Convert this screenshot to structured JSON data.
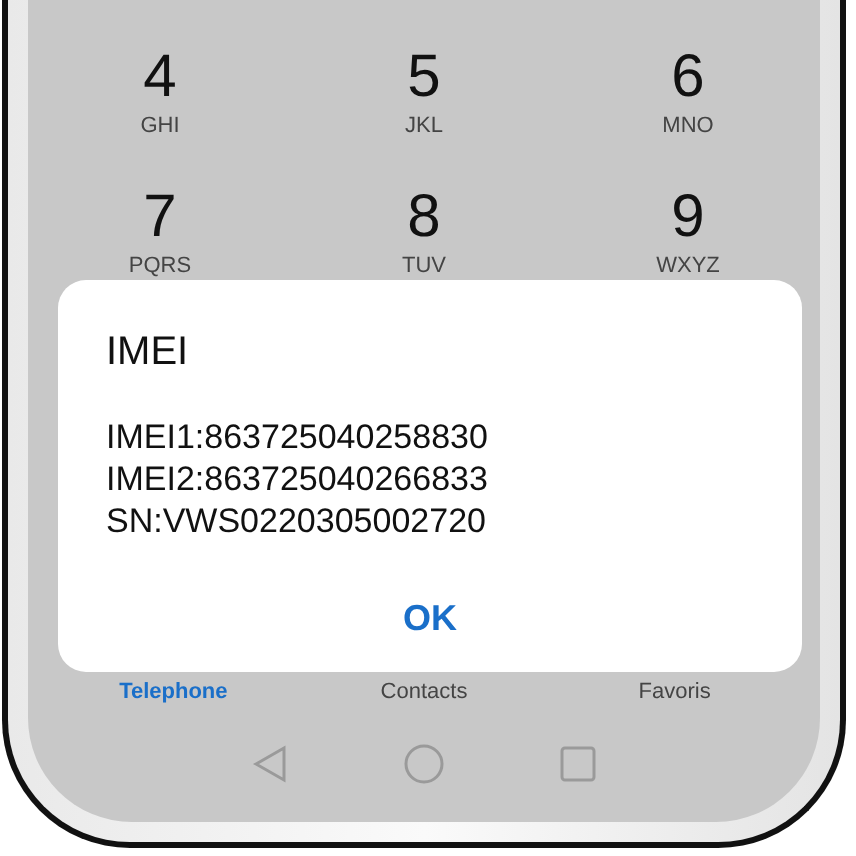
{
  "keypad": [
    {
      "digit": "4",
      "letters": "GHI"
    },
    {
      "digit": "5",
      "letters": "JKL"
    },
    {
      "digit": "6",
      "letters": "MNO"
    },
    {
      "digit": "7",
      "letters": "PQRS"
    },
    {
      "digit": "8",
      "letters": "TUV"
    },
    {
      "digit": "9",
      "letters": "WXYZ"
    }
  ],
  "dialog": {
    "title": "IMEI",
    "lines": [
      "IMEI1:863725040258830",
      "IMEI2:863725040266833",
      "SN:VWS0220305002720"
    ],
    "button": "OK"
  },
  "tabs": [
    {
      "label": "Telephone",
      "selected": true
    },
    {
      "label": "Contacts",
      "selected": false
    },
    {
      "label": "Favoris",
      "selected": false
    }
  ]
}
